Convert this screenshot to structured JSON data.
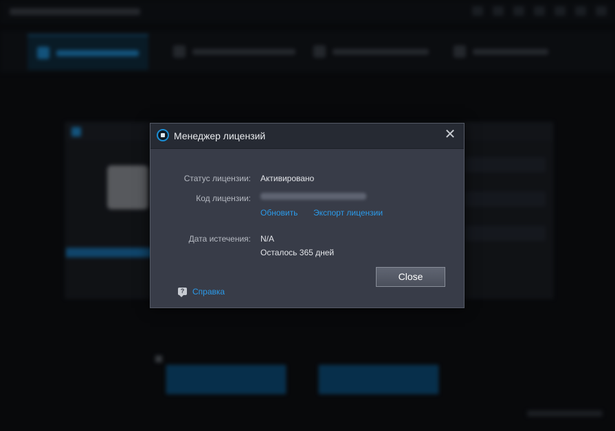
{
  "dialog": {
    "title": "Менеджер лицензий",
    "close_glyph": "✕",
    "status_label": "Статус лицензии:",
    "status_value": "Активировано",
    "key_label": "Код лицензии:",
    "update_link": "Обновить",
    "export_link": "Экспорт лицензии",
    "expiry_label": "Дата истечения:",
    "expiry_value": "N/A",
    "remaining_text": "Осталось 365 дней",
    "close_button": "Close",
    "help_link": "Справка",
    "help_icon_glyph": "?"
  },
  "icons": {
    "dialog_logo": "app-logo-icon",
    "close": "close-icon",
    "help": "help-bubble-icon"
  },
  "colors": {
    "accent": "#2b9bea",
    "dialog_bg": "#383c48",
    "header_bg": "#262a33"
  }
}
